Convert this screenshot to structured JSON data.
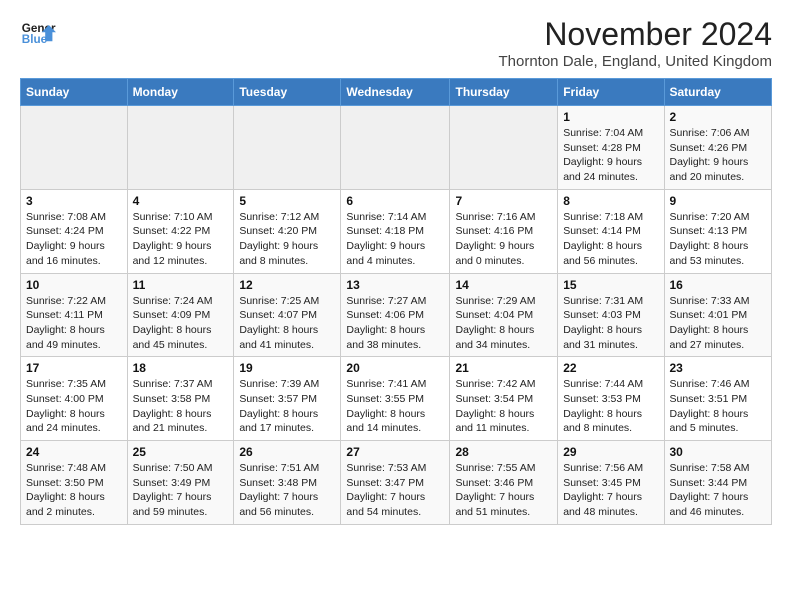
{
  "logo": {
    "line1": "General",
    "line2": "Blue"
  },
  "title": "November 2024",
  "location": "Thornton Dale, England, United Kingdom",
  "days_header": [
    "Sunday",
    "Monday",
    "Tuesday",
    "Wednesday",
    "Thursday",
    "Friday",
    "Saturday"
  ],
  "weeks": [
    [
      {
        "day": "",
        "info": ""
      },
      {
        "day": "",
        "info": ""
      },
      {
        "day": "",
        "info": ""
      },
      {
        "day": "",
        "info": ""
      },
      {
        "day": "",
        "info": ""
      },
      {
        "day": "1",
        "info": "Sunrise: 7:04 AM\nSunset: 4:28 PM\nDaylight: 9 hours and 24 minutes."
      },
      {
        "day": "2",
        "info": "Sunrise: 7:06 AM\nSunset: 4:26 PM\nDaylight: 9 hours and 20 minutes."
      }
    ],
    [
      {
        "day": "3",
        "info": "Sunrise: 7:08 AM\nSunset: 4:24 PM\nDaylight: 9 hours and 16 minutes."
      },
      {
        "day": "4",
        "info": "Sunrise: 7:10 AM\nSunset: 4:22 PM\nDaylight: 9 hours and 12 minutes."
      },
      {
        "day": "5",
        "info": "Sunrise: 7:12 AM\nSunset: 4:20 PM\nDaylight: 9 hours and 8 minutes."
      },
      {
        "day": "6",
        "info": "Sunrise: 7:14 AM\nSunset: 4:18 PM\nDaylight: 9 hours and 4 minutes."
      },
      {
        "day": "7",
        "info": "Sunrise: 7:16 AM\nSunset: 4:16 PM\nDaylight: 9 hours and 0 minutes."
      },
      {
        "day": "8",
        "info": "Sunrise: 7:18 AM\nSunset: 4:14 PM\nDaylight: 8 hours and 56 minutes."
      },
      {
        "day": "9",
        "info": "Sunrise: 7:20 AM\nSunset: 4:13 PM\nDaylight: 8 hours and 53 minutes."
      }
    ],
    [
      {
        "day": "10",
        "info": "Sunrise: 7:22 AM\nSunset: 4:11 PM\nDaylight: 8 hours and 49 minutes."
      },
      {
        "day": "11",
        "info": "Sunrise: 7:24 AM\nSunset: 4:09 PM\nDaylight: 8 hours and 45 minutes."
      },
      {
        "day": "12",
        "info": "Sunrise: 7:25 AM\nSunset: 4:07 PM\nDaylight: 8 hours and 41 minutes."
      },
      {
        "day": "13",
        "info": "Sunrise: 7:27 AM\nSunset: 4:06 PM\nDaylight: 8 hours and 38 minutes."
      },
      {
        "day": "14",
        "info": "Sunrise: 7:29 AM\nSunset: 4:04 PM\nDaylight: 8 hours and 34 minutes."
      },
      {
        "day": "15",
        "info": "Sunrise: 7:31 AM\nSunset: 4:03 PM\nDaylight: 8 hours and 31 minutes."
      },
      {
        "day": "16",
        "info": "Sunrise: 7:33 AM\nSunset: 4:01 PM\nDaylight: 8 hours and 27 minutes."
      }
    ],
    [
      {
        "day": "17",
        "info": "Sunrise: 7:35 AM\nSunset: 4:00 PM\nDaylight: 8 hours and 24 minutes."
      },
      {
        "day": "18",
        "info": "Sunrise: 7:37 AM\nSunset: 3:58 PM\nDaylight: 8 hours and 21 minutes."
      },
      {
        "day": "19",
        "info": "Sunrise: 7:39 AM\nSunset: 3:57 PM\nDaylight: 8 hours and 17 minutes."
      },
      {
        "day": "20",
        "info": "Sunrise: 7:41 AM\nSunset: 3:55 PM\nDaylight: 8 hours and 14 minutes."
      },
      {
        "day": "21",
        "info": "Sunrise: 7:42 AM\nSunset: 3:54 PM\nDaylight: 8 hours and 11 minutes."
      },
      {
        "day": "22",
        "info": "Sunrise: 7:44 AM\nSunset: 3:53 PM\nDaylight: 8 hours and 8 minutes."
      },
      {
        "day": "23",
        "info": "Sunrise: 7:46 AM\nSunset: 3:51 PM\nDaylight: 8 hours and 5 minutes."
      }
    ],
    [
      {
        "day": "24",
        "info": "Sunrise: 7:48 AM\nSunset: 3:50 PM\nDaylight: 8 hours and 2 minutes."
      },
      {
        "day": "25",
        "info": "Sunrise: 7:50 AM\nSunset: 3:49 PM\nDaylight: 7 hours and 59 minutes."
      },
      {
        "day": "26",
        "info": "Sunrise: 7:51 AM\nSunset: 3:48 PM\nDaylight: 7 hours and 56 minutes."
      },
      {
        "day": "27",
        "info": "Sunrise: 7:53 AM\nSunset: 3:47 PM\nDaylight: 7 hours and 54 minutes."
      },
      {
        "day": "28",
        "info": "Sunrise: 7:55 AM\nSunset: 3:46 PM\nDaylight: 7 hours and 51 minutes."
      },
      {
        "day": "29",
        "info": "Sunrise: 7:56 AM\nSunset: 3:45 PM\nDaylight: 7 hours and 48 minutes."
      },
      {
        "day": "30",
        "info": "Sunrise: 7:58 AM\nSunset: 3:44 PM\nDaylight: 7 hours and 46 minutes."
      }
    ]
  ]
}
